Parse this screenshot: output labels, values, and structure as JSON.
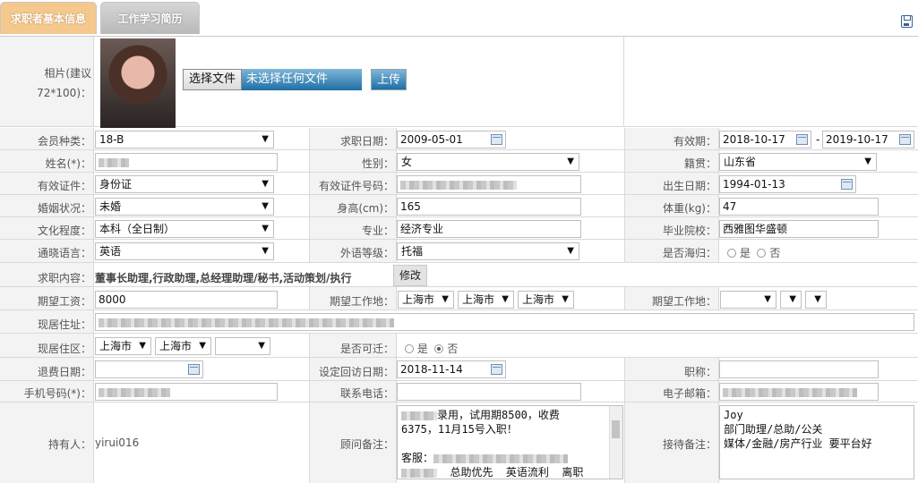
{
  "tabs": [
    {
      "label": "求职者基本信息"
    },
    {
      "label": "工作学习简历"
    }
  ],
  "photo": {
    "label": "相片(建议72*100)：",
    "choose_btn": "选择文件",
    "file_status": "未选择任何文件",
    "upload_btn": "上传"
  },
  "rows": {
    "member_type": {
      "label": "会员种类：",
      "value": "18-B"
    },
    "job_date": {
      "label": "求职日期：",
      "value": "2009-05-01"
    },
    "valid_period": {
      "label": "有效期：",
      "from": "2018-10-17",
      "sep": "-",
      "to": "2019-10-17"
    },
    "name": {
      "label": "姓名(*)："
    },
    "gender": {
      "label": "性别：",
      "value": "女"
    },
    "native": {
      "label": "籍贯：",
      "value": "山东省"
    },
    "id_type": {
      "label": "有效证件：",
      "value": "身份证"
    },
    "id_no": {
      "label": "有效证件号码："
    },
    "birth": {
      "label": "出生日期：",
      "value": "1994-01-13"
    },
    "marriage": {
      "label": "婚姻状况：",
      "value": "未婚"
    },
    "height": {
      "label": "身高(cm)：",
      "value": "165"
    },
    "weight": {
      "label": "体重(kg)：",
      "value": "47"
    },
    "education": {
      "label": "文化程度：",
      "value": "本科（全日制）"
    },
    "major": {
      "label": "专业：",
      "value": "经济专业"
    },
    "school": {
      "label": "毕业院校：",
      "value": "西雅图华盛顿"
    },
    "language": {
      "label": "通晓语言：",
      "value": "英语"
    },
    "lang_level": {
      "label": "外语等级：",
      "value": "托福"
    },
    "overseas": {
      "label": "是否海归：",
      "yes": "是",
      "no": "否"
    },
    "job_content": {
      "label": "求职内容：",
      "value": "董事长助理,行政助理,总经理助理/秘书,活动策划/执行",
      "modify_btn": "修改"
    },
    "salary": {
      "label": "期望工资：",
      "value": "8000"
    },
    "work_place": {
      "label": "期望工作地：",
      "v1": "上海市",
      "v2": "上海市",
      "v3": "上海市"
    },
    "work_place2": {
      "label": "期望工作地："
    },
    "address": {
      "label": "现居住址："
    },
    "area": {
      "label": "现居住区：",
      "v1": "上海市",
      "v2": "上海市"
    },
    "relocate": {
      "label": "是否可迁：",
      "yes": "是",
      "no": "否"
    },
    "refund_date": {
      "label": "退费日期："
    },
    "visit_date": {
      "label": "设定回访日期：",
      "value": "2018-11-14"
    },
    "title": {
      "label": "职称："
    },
    "mobile": {
      "label": "手机号码(*)："
    },
    "phone": {
      "label": "联系电话："
    },
    "email": {
      "label": "电子邮箱："
    },
    "holder": {
      "label": "持有人：",
      "value": "yirui016"
    },
    "consultant_note": {
      "label": "顾问备注：",
      "line1": "录用，试用期8500，收费",
      "line2": "6375，11月15号入职！",
      "line3": "客服：",
      "line4": "总助优先  英语流利  离职"
    },
    "reception_note": {
      "label": "接待备注：",
      "line1": "Joy",
      "line2": "部门助理/总助/公关",
      "line3": "媒体/金融/房产行业 要平台好"
    }
  }
}
